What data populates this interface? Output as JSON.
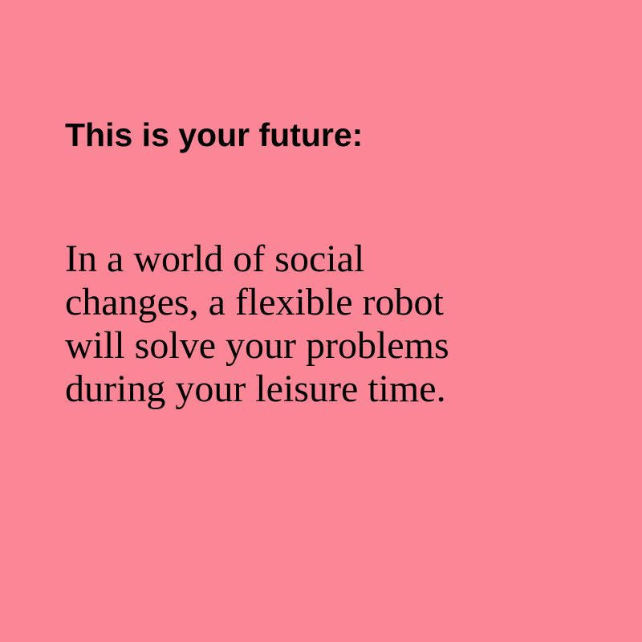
{
  "colors": {
    "background": "#fa8696",
    "text": "#000000"
  },
  "card": {
    "headline": "This is your future:",
    "body_lines": [
      "In a world of social",
      "changes, a flexible robot",
      "will solve your problems",
      "during your leisure time."
    ]
  }
}
